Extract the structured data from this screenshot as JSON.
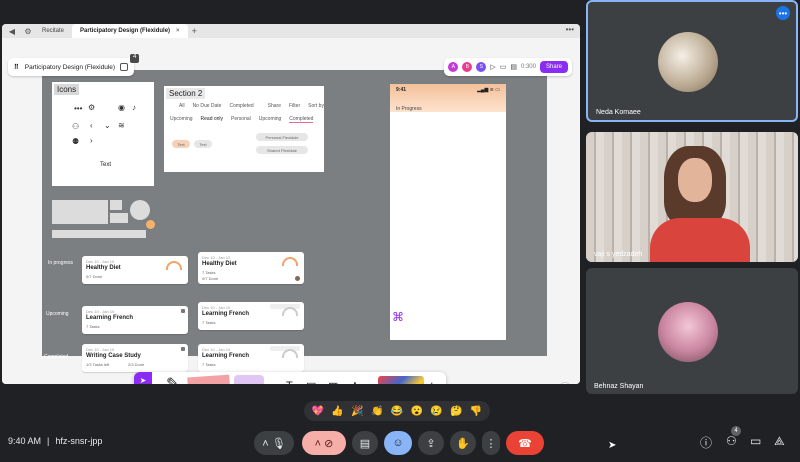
{
  "browser": {
    "tabs": [
      {
        "label": "Recitate",
        "active": false
      },
      {
        "label": "Participatory Design (Flexidule)",
        "active": true
      }
    ]
  },
  "figma": {
    "file_title": "Participatory Design (Flexidule)",
    "file_tag": "4",
    "avatars": [
      "A",
      "B",
      "S"
    ],
    "timer": "0:300",
    "share_label": "Share",
    "icons_frame": {
      "title": "Icons",
      "text_label": "Text"
    },
    "section2": {
      "title": "Section 2",
      "row1": [
        "All",
        "No Due Date",
        "Completed",
        "Share",
        "Filter",
        "Sort by"
      ],
      "row2": [
        "Upcoming",
        "Read only",
        "Personal",
        "Upcoming",
        "Completed"
      ],
      "pills": [
        "Text",
        "Text",
        "Personal Flexidule",
        "Shared Flexidule"
      ]
    },
    "phone": {
      "time": "9:41",
      "status_label": "In Progress"
    },
    "row_labels": [
      "In progress",
      "Upcoming",
      "Completed"
    ],
    "cards": [
      {
        "date": "Dec 10 - Jan 10",
        "title": "Healthy Diet",
        "meta": "0/7 Done",
        "meta2": ""
      },
      {
        "date": "Dec 10 - Jan 10",
        "title": "Healthy Diet",
        "meta": "7 Tasks",
        "meta2": "0/7 Done"
      },
      {
        "date": "Dec 10 - Jan 10",
        "title": "Learning French",
        "meta": "7 Tasks",
        "meta2": ""
      },
      {
        "date": "Dec 10 - Jan 10",
        "title": "Learning French",
        "meta": "7 Tasks",
        "meta2": ""
      },
      {
        "date": "Dec 10 - Jan 10",
        "title": "Writing Case Study",
        "meta": "1/3 Tasks left",
        "meta2": "2/3 Done"
      },
      {
        "date": "Dec 10 - Jan 10",
        "title": "Learning French",
        "meta": "7 Tasks",
        "meta2": ""
      }
    ],
    "zoom_minus": "−",
    "zoom_plus": "+",
    "help": "?"
  },
  "participants": [
    {
      "name": "Neda Komaee"
    },
    {
      "name": "vaji s yedzadeh"
    },
    {
      "name": "Behnaz Shayan"
    }
  ],
  "reactions": [
    "💖",
    "👍",
    "🎉",
    "👏",
    "😂",
    "😮",
    "😢",
    "🤔",
    "👎"
  ],
  "meeting": {
    "time": "9:40 AM",
    "separator": "|",
    "code": "hfz-snsr-jpp",
    "people_count": "4"
  },
  "colors": {
    "accent": "#8b2cf5",
    "end_call": "#ea4335",
    "active_ctrl": "#8ab4f8"
  }
}
